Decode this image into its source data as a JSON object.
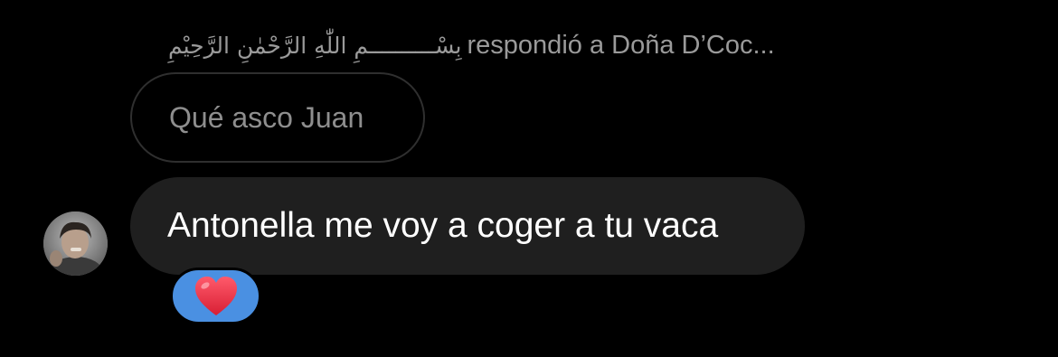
{
  "reply_header": {
    "sender_display_name": "بِسْــــــــــمِ اللّٰهِ الرَّحْمٰنِ الرَّحِيْمِ",
    "text": "respondió a Doña D’Coc..."
  },
  "quoted_message": {
    "text": "Qué asco Juan"
  },
  "message": {
    "text": "Antonella me voy a coger a tu vaca"
  },
  "reaction": {
    "emoji": "heart-icon",
    "color": "#ef3b4f",
    "pill_color": "#4a90e2"
  },
  "colors": {
    "background": "#000000",
    "message_bubble": "#1f1f1f",
    "quoted_border": "#2f2f2f",
    "secondary_text": "#9a9a9a"
  }
}
